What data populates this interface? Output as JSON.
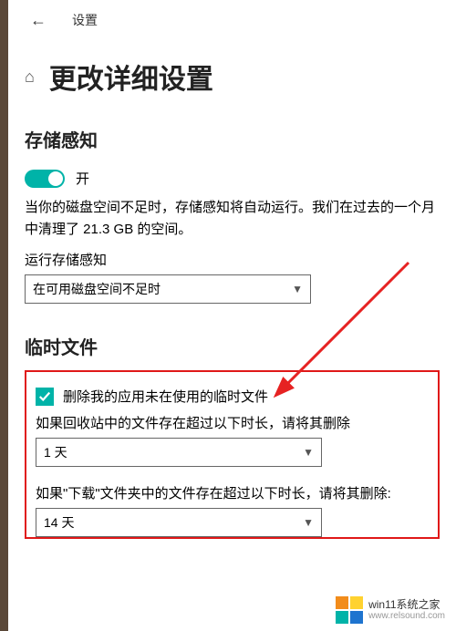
{
  "topbar": {
    "settings_label": "设置"
  },
  "title": "更改详细设置",
  "storage_sense": {
    "heading": "存储感知",
    "toggle_label": "开",
    "description": "当你的磁盘空间不足时，存储感知将自动运行。我们在过去的一个月中清理了 21.3 GB 的空间。",
    "run_label": "运行存储感知",
    "select_value": "在可用磁盘空间不足时"
  },
  "temp_files": {
    "heading": "临时文件",
    "checkbox_label": "删除我的应用未在使用的临时文件",
    "recycle_hint": "如果回收站中的文件存在超过以下时长，请将其删除",
    "recycle_value": "1 天",
    "downloads_hint": "如果\"下载\"文件夹中的文件存在超过以下时长，请将其删除:",
    "downloads_value": "14 天"
  },
  "watermark": {
    "line1": "win11系统之家",
    "line2": "www.relsound.com"
  },
  "colors": {
    "teal": "#00b3a8",
    "red": "#e01818",
    "arrow": "#e62222"
  }
}
